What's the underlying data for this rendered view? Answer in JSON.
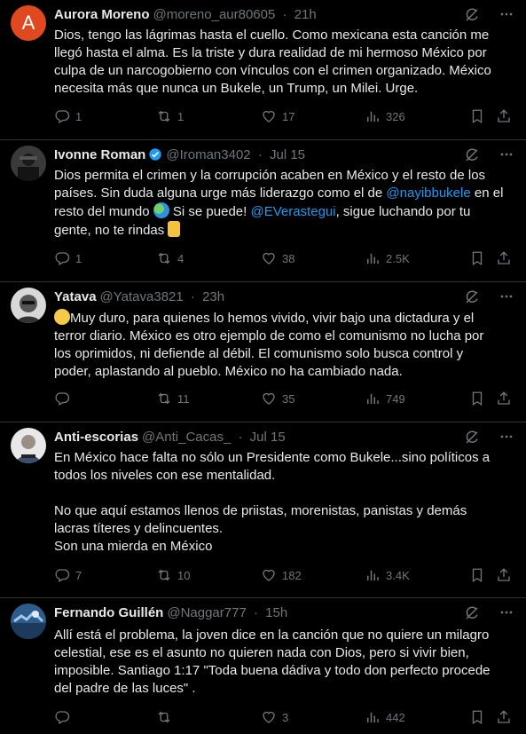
{
  "tweets": [
    {
      "name": "Aurora Moreno",
      "handle": "@moreno_aur80605",
      "sep": "·",
      "time": "21h",
      "avatar_letter": "A",
      "lines": [
        "Dios, tengo las lágrimas hasta el cuello. Como mexicana esta canción me",
        "llegó hasta el alma. Es la triste y dura realidad de mi hermoso México por",
        "culpa de un narcogobierno con vínculos con el crimen organizado. México",
        "necesita más que nunca un Bukele, un Trump, un Milei. Urge."
      ],
      "replies": "1",
      "reposts": "1",
      "likes": "17",
      "views": "326"
    },
    {
      "name": "Ivonne Roman",
      "handle": "@Iroman3402",
      "sep": "·",
      "time": "Jul 15",
      "line1": "Dios permita el crimen y la  corrupción acaben en México y el resto de los",
      "line2_a": "países. Sin duda alguna urge más liderazgo como el de ",
      "mention1": "@nayibbukele",
      "line2_b": " en el",
      "line3_a": "resto del mundo ",
      "line3_b": " Si se puede! ",
      "mention2": "@EVerastegui",
      "line3_c": ", sigue luchando por tu",
      "line4": "gente, no te rindas ",
      "replies": "1",
      "reposts": "4",
      "likes": "38",
      "views": "2.5K"
    },
    {
      "name": "Yatava",
      "handle": "@Yatava3821",
      "sep": "·",
      "time": "23h",
      "line1": "Muy duro, para quienes lo hemos vivido, vivir bajo una dictadura y el",
      "lines": [
        "terror diario. México es otro ejemplo de como el comunismo no lucha por",
        "los oprimidos, ni defiende al débil. El comunismo solo busca control y",
        "poder, aplastando al pueblo. México no ha cambiado nada."
      ],
      "replies": "",
      "reposts": "11",
      "likes": "35",
      "views": "749"
    },
    {
      "name": "Anti-escorias",
      "handle": "@Anti_Cacas_",
      "sep": "·",
      "time": "Jul 15",
      "lines": [
        "En México hace falta no sólo un Presidente como Bukele...sino políticos a",
        "todos los niveles con ese mentalidad.",
        "",
        "No que aquí estamos llenos de priistas, morenistas, panistas y demás",
        "lacras títeres y delincuentes.",
        "Son una mierda en México"
      ],
      "replies": "7",
      "reposts": "10",
      "likes": "182",
      "views": "3.4K"
    },
    {
      "name": "Fernando Guillén",
      "handle": "@Naggar777",
      "sep": "·",
      "time": "15h",
      "lines": [
        "Allí está el problema, la joven dice en la canción que no quiere un milagro",
        "celestial, ese es el asunto no quieren nada con Dios, pero si vivir bien,",
        "imposible. Santiago 1:17 \"Toda buena dádiva y todo don perfecto procede",
        "del padre de las luces\" ."
      ],
      "replies": "",
      "reposts": "",
      "likes": "3",
      "views": "442"
    }
  ],
  "colors": {
    "background": "#000000",
    "text": "#e7e9ea",
    "muted": "#71767b",
    "link": "#1d9bf0",
    "divider": "#2f3336"
  }
}
